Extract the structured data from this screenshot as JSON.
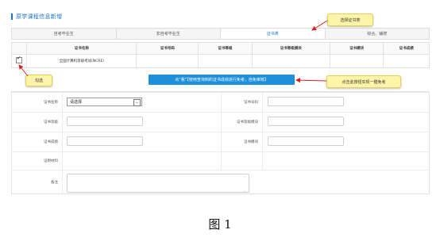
{
  "header": {
    "title": "原学课程信息新增"
  },
  "tabs": [
    {
      "label": "自考毕业生"
    },
    {
      "label": "非自考毕业生"
    },
    {
      "label": "证书类"
    },
    {
      "label": "综合、辅修"
    }
  ],
  "table": {
    "columns": [
      "证书名称",
      "证书号码",
      "证书等级",
      "证书等级模块",
      "证书模块",
      "证书成绩"
    ],
    "rows": [
      {
        "checked": true,
        "cells": [
          "全国计算机等级考试(NCRE)",
          "",
          "",
          "",
          "",
          ""
        ]
      }
    ]
  },
  "callouts": {
    "select_cert": "选择证书类",
    "check": "勾选",
    "click_btn": "点击此按钮实现一键免考"
  },
  "banner": {
    "text": "点“我”【使用查询到的证书成绩进行免考，自免审核】"
  },
  "form": {
    "cert_name_label": "证书名称",
    "cert_name_value": "请选择",
    "cert_no_label": "证书号码",
    "cert_level_label": "证书等级",
    "cert_level_module_label": "证书等级模块",
    "cert_score_label": "证书成绩",
    "cert_module_label": "证书模块",
    "cert_material_label": "证明材料",
    "remark_label": "备注"
  },
  "caption": "图 1",
  "colors": {
    "accent": "#1a73c9",
    "banner": "#1e90d9",
    "callout": "#fff5a8",
    "arrow": "#d62020"
  }
}
